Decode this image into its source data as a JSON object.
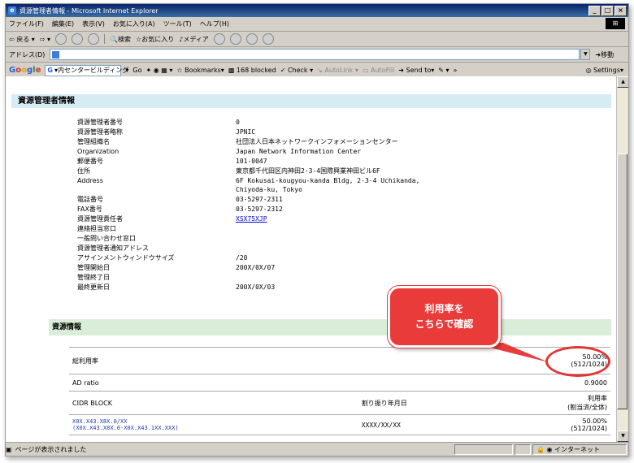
{
  "window": {
    "title": "資源管理者情報 - Microsoft Internet Explorer",
    "min": "_",
    "max": "□",
    "close": "×"
  },
  "menubar": [
    "ファイル(F)",
    "編集(E)",
    "表示(V)",
    "お気に入り(A)",
    "ツール(T)",
    "ヘルプ(H)"
  ],
  "toolbar": {
    "back": "戻る",
    "search": "検索",
    "favorites": "お気に入り",
    "media": "メディア"
  },
  "address": {
    "label": "アドレス(D)",
    "go": "移動"
  },
  "googlebar": {
    "logo": "Google",
    "search_value": "▾内センタービルディング",
    "go": "Go",
    "bookmarks": "Bookmarks",
    "blocked": "168 blocked",
    "check": "Check",
    "autolink": "AutoLink",
    "autofill": "AutoFill",
    "sendto": "Send to",
    "more": "»",
    "settings": "Settings"
  },
  "section1": {
    "title": "資源管理者情報",
    "rows": [
      {
        "label": "資源管理者番号",
        "value": "0"
      },
      {
        "label": "資源管理者略称",
        "value": "JPNIC"
      },
      {
        "label": "管理組織名",
        "value": "社団法人日本ネットワークインフォメーションセンター"
      },
      {
        "label": "Organization",
        "value": "Japan Network Information Center"
      },
      {
        "label": "郵便番号",
        "value": "101-0047"
      },
      {
        "label": "住所",
        "value": "東京都千代田区内神田2-3-4国際興業神田ビル6F"
      },
      {
        "label": "Address",
        "value": "6F Kokusai-kougyou-kanda Bldg, 2-3-4 Uchikanda,",
        "value2": "Chiyoda-ku, Tokyo"
      },
      {
        "label": "電話番号",
        "value": "03-5297-2311"
      },
      {
        "label": "FAX番号",
        "value": "03-5297-2312"
      },
      {
        "label": "資源管理責任者",
        "value": "XSX75XJP"
      },
      {
        "label": "連絡担当窓口",
        "value": ""
      },
      {
        "label": "一般問い合わせ窓口",
        "value": ""
      },
      {
        "label": "資源管理者通知アドレス",
        "value": ""
      },
      {
        "label": "アサインメントウィンドウサイズ",
        "value": "/20"
      },
      {
        "label": "管理開始日",
        "value": "200X/0X/07"
      },
      {
        "label": "管理終了日",
        "value": ""
      },
      {
        "label": "最終更新日",
        "value": "200X/0X/03"
      }
    ]
  },
  "section2": {
    "title": "資源情報",
    "total_label": "総利用率",
    "total_pct": "50.00%",
    "total_frac": "(512/1024)",
    "ad_label": "AD ratio",
    "ad_value": "0.9000",
    "cidr_header": "CIDR BLOCK",
    "date_header": "割り振り年月日",
    "rate_header1": "利用率",
    "rate_header2": "(割当済/全体)",
    "row": {
      "cidr1": "X0X.X43.X8X.0/XX",
      "cidr2": "(X0X.X43.X8X.0-X0X.X43.1XX.XXX)",
      "date": "XXXX/XX/XX",
      "pct": "50.00%",
      "frac": "(512/1024)"
    }
  },
  "callout": {
    "line1": "利用率を",
    "line2": "こちらで確認"
  },
  "statusbar": {
    "text": "ページが表示されました",
    "zone": "インターネット"
  },
  "colors": {
    "section1_bg": "#d6ecf5",
    "section2_bg": "#d9edd8",
    "callout": "#ea3b3b"
  }
}
